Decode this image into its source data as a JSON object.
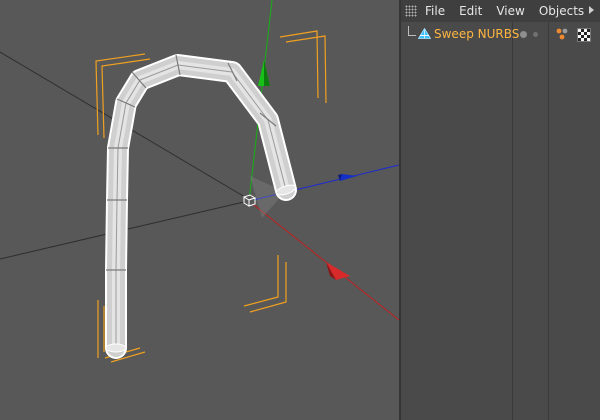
{
  "menubar": {
    "items": [
      "File",
      "Edit",
      "View",
      "Objects"
    ],
    "grip_icon": "grip-dots-icon",
    "more_icon": "arrow-right-icon"
  },
  "objects": [
    {
      "name": "Sweep NURBS",
      "icon": "sweep-nurbs-icon",
      "name_color": "#ffb640"
    }
  ],
  "viewport": {
    "axis_colors": {
      "x": "#d02020",
      "y": "#16b016",
      "z": "#1c2cd0"
    },
    "selection_bracket_color": "#f0a020"
  }
}
